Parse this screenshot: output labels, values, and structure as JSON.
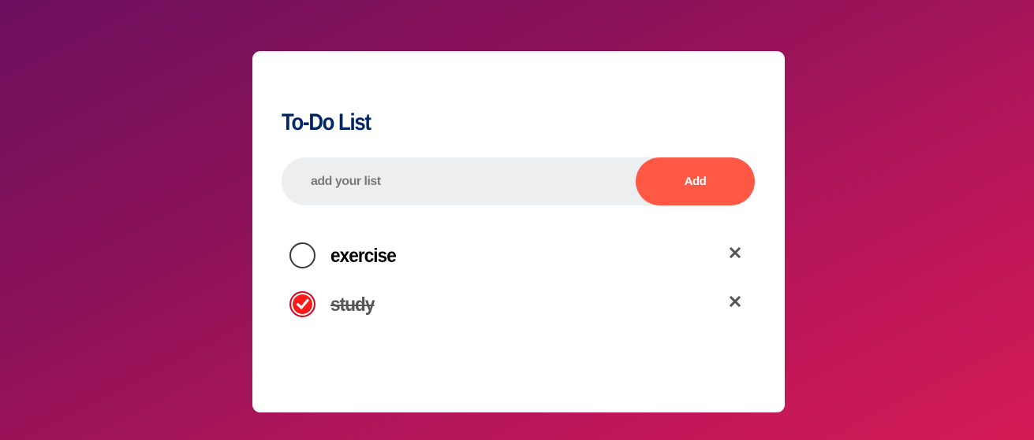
{
  "app": {
    "title": "To-Do List"
  },
  "input": {
    "placeholder": "add your list",
    "value": ""
  },
  "add_button": {
    "label": "Add"
  },
  "todos": [
    {
      "text": "exercise",
      "checked": false,
      "check_icon": "circle-unchecked-icon",
      "delete_icon": "close-icon"
    },
    {
      "text": "study",
      "checked": true,
      "check_icon": "checkmark-icon",
      "delete_icon": "close-icon"
    }
  ],
  "colors": {
    "title": "#002765",
    "accent": "#ff5945",
    "checked": "#ff1a1a",
    "input_bg": "#edeef0",
    "background_start": "#6c0f5e",
    "background_end": "#d41a55"
  }
}
